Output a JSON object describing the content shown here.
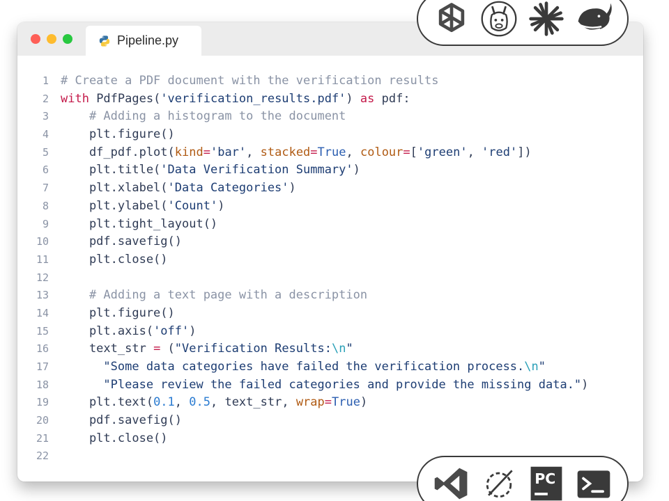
{
  "window": {
    "traffic_lights": [
      "close",
      "minimize",
      "maximize"
    ],
    "tab": {
      "icon": "python-icon",
      "label": "Pipeline.py"
    }
  },
  "code_lines": [
    {
      "n": "1",
      "text": "# Create a PDF document with the verification results"
    },
    {
      "n": "2",
      "text": "with PdfPages('verification_results.pdf') as pdf:"
    },
    {
      "n": "3",
      "text": "    # Adding a histogram to the document"
    },
    {
      "n": "4",
      "text": "    plt.figure()"
    },
    {
      "n": "5",
      "text": "    df_pdf.plot(kind='bar', stacked=True, colour=['green', 'red'])"
    },
    {
      "n": "6",
      "text": "    plt.title('Data Verification Summary')"
    },
    {
      "n": "7",
      "text": "    plt.xlabel('Data Categories')"
    },
    {
      "n": "8",
      "text": "    plt.ylabel('Count')"
    },
    {
      "n": "9",
      "text": "    plt.tight_layout()"
    },
    {
      "n": "10",
      "text": "    pdf.savefig()"
    },
    {
      "n": "11",
      "text": "    plt.close()"
    },
    {
      "n": "12",
      "text": ""
    },
    {
      "n": "13",
      "text": "    # Adding a text page with a description"
    },
    {
      "n": "14",
      "text": "    plt.figure()"
    },
    {
      "n": "15",
      "text": "    plt.axis('off')"
    },
    {
      "n": "16",
      "text": "    text_str = (\"Verification Results:\\n\""
    },
    {
      "n": "17",
      "text": "      \"Some data categories have failed the verification process.\\n\""
    },
    {
      "n": "18",
      "text": "      \"Please review the failed categories and provide the missing data.\")"
    },
    {
      "n": "19",
      "text": "    plt.text(0.1, 0.5, text_str, wrap=True)"
    },
    {
      "n": "20",
      "text": "    pdf.savefig()"
    },
    {
      "n": "21",
      "text": "    plt.close()"
    },
    {
      "n": "22",
      "text": ""
    }
  ],
  "badges": {
    "top": [
      "openai-icon",
      "llama-icon",
      "asterisk-starburst-icon",
      "whale-icon"
    ],
    "bottom": [
      "vscode-icon",
      "eclipse-icon",
      "pycharm-icon",
      "terminal-icon"
    ],
    "pycharm_text": "PC"
  },
  "colors": {
    "comment": "#8a93a5",
    "keyword": "#c41a4a",
    "string": "#1d3d73",
    "number": "#2a7bd1",
    "kwarg": "#b05b14"
  }
}
